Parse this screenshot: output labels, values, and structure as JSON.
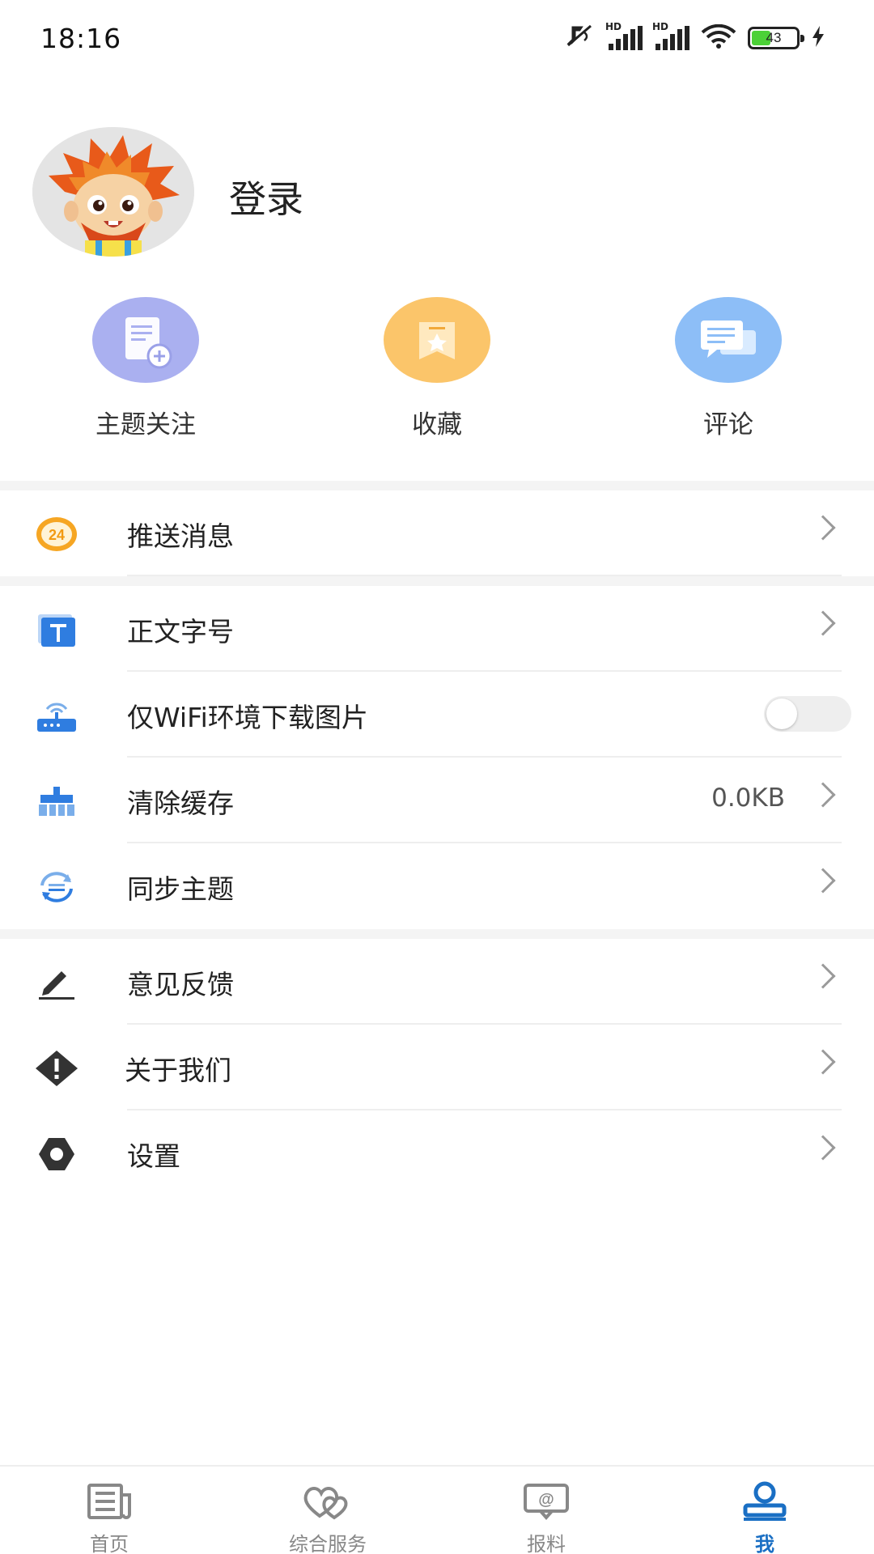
{
  "status_bar": {
    "time": "18:16",
    "battery": 43,
    "hd1": "HD",
    "hd2": "HD",
    "icons": [
      "mute-icon",
      "signal-icon",
      "signal-icon",
      "wifi-icon",
      "battery-icon",
      "charging-icon"
    ]
  },
  "profile": {
    "login_label": "登录",
    "avatar": "cartoon-mascot-avatar"
  },
  "quick_actions": [
    {
      "label": "主题关注",
      "icon": "document-add-icon",
      "color": "#aab0f0"
    },
    {
      "label": "收藏",
      "icon": "bookmark-icon",
      "color": "#fbc56a"
    },
    {
      "label": "评论",
      "icon": "comment-icon",
      "color": "#8dbef7"
    }
  ],
  "menu": {
    "push": {
      "label": "推送消息",
      "icon": "24h-icon"
    },
    "font_size": {
      "label": "正文字号",
      "icon": "text-icon"
    },
    "wifi_images": {
      "label": "仅WiFi环境下载图片",
      "icon": "router-icon",
      "toggle_on": false
    },
    "clear_cache": {
      "label": "清除缓存",
      "value": "0.0KB",
      "icon": "broom-icon"
    },
    "sync_topics": {
      "label": "同步主题",
      "icon": "sync-icon"
    },
    "feedback": {
      "label": "意见反馈",
      "icon": "edit-icon"
    },
    "about": {
      "label": "关于我们",
      "icon": "info-diamond-icon"
    },
    "settings": {
      "label": "设置",
      "icon": "gear-icon"
    }
  },
  "bottom_nav": [
    {
      "label": "首页",
      "icon": "news-icon",
      "active": false
    },
    {
      "label": "综合服务",
      "icon": "hearts-icon",
      "active": false
    },
    {
      "label": "报料",
      "icon": "at-message-icon",
      "active": false
    },
    {
      "label": "我",
      "icon": "user-icon",
      "active": true
    }
  ],
  "colors": {
    "accent": "#1a6fc4",
    "band": "#f4f4f4"
  }
}
